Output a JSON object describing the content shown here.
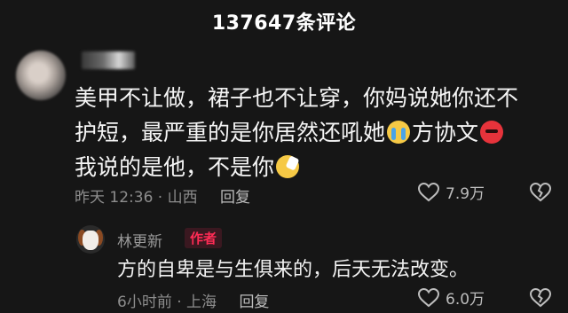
{
  "header": {
    "comment_count": "137647条评论"
  },
  "comment": {
    "line1": "美甲不让做，裙子也不让穿，你妈说她你还不",
    "line2_a": "护短，最严重的是你居然还吼她",
    "line2_b": "方协文",
    "line3": "我说的是他，不是你",
    "time": "昨天 12:36 · 山西",
    "reply_label": "回复",
    "likes": "7.9万",
    "emojis": [
      "cry-emoji",
      "angry-emoji",
      "salute-emoji"
    ]
  },
  "reply": {
    "author": "林更新",
    "badge": "作者",
    "text": "方的自卑是与生俱来的，后天无法改变。",
    "time": "6小时前 · 上海",
    "reply_label": "回复",
    "likes": "6.0万"
  },
  "colors": {
    "background": "#161616",
    "badge": "#ff2c55",
    "meta": "#8d8d8d"
  }
}
